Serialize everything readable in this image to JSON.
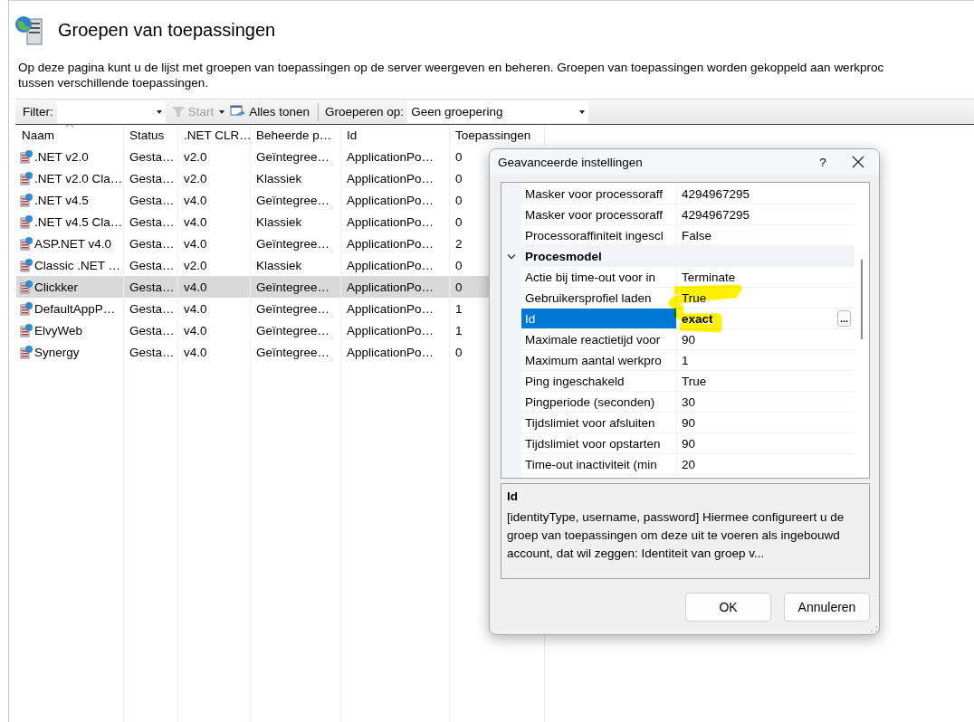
{
  "header": {
    "title": "Groepen van toepassingen",
    "description_lines": [
      "Op deze pagina kunt u de lijst met groepen van toepassingen op de server weergeven en beheren. Groepen van toepassingen worden gekoppeld aan werkproc",
      "tussen verschillende toepassingen."
    ]
  },
  "toolbar": {
    "filter_label": "Filter:",
    "start_button": {
      "label": "Start",
      "disabled": true
    },
    "show_all_button": "Alles tonen",
    "group_label": "Groeperen op:",
    "group_value": "Geen groepering"
  },
  "table": {
    "columns": [
      "Naam",
      "Status",
      ".NET CLR…",
      "Beheerde p…",
      "Id",
      "Toepassingen"
    ],
    "rows": [
      {
        "cells": [
          ".NET v2.0",
          "Gesta…",
          "v2.0",
          "Geïntegree…",
          "ApplicationPo…",
          "0"
        ],
        "selected": false
      },
      {
        "cells": [
          ".NET v2.0 Cla…",
          "Gesta…",
          "v2.0",
          "Klassiek",
          "ApplicationPo…",
          "0"
        ],
        "selected": false
      },
      {
        "cells": [
          ".NET v4.5",
          "Gesta…",
          "v4.0",
          "Geïntegree…",
          "ApplicationPo…",
          "0"
        ],
        "selected": false
      },
      {
        "cells": [
          ".NET v4.5 Cla…",
          "Gesta…",
          "v4.0",
          "Klassiek",
          "ApplicationPo…",
          "0"
        ],
        "selected": false
      },
      {
        "cells": [
          "ASP.NET v4.0",
          "Gesta…",
          "v4.0",
          "Geïntegree…",
          "ApplicationPo…",
          "2"
        ],
        "selected": false
      },
      {
        "cells": [
          "Classic .NET …",
          "Gesta…",
          "v2.0",
          "Klassiek",
          "ApplicationPo…",
          "0"
        ],
        "selected": false
      },
      {
        "cells": [
          "Clickker",
          "Gesta…",
          "v4.0",
          "Geïntegree…",
          "ApplicationPo…",
          "0"
        ],
        "selected": true
      },
      {
        "cells": [
          "DefaultAppP…",
          "Gesta…",
          "v4.0",
          "Geïntegree…",
          "ApplicationPo…",
          "1"
        ],
        "selected": false
      },
      {
        "cells": [
          "ElvyWeb",
          "Gesta…",
          "v4.0",
          "Geïntegree…",
          "ApplicationPo…",
          "1"
        ],
        "selected": false
      },
      {
        "cells": [
          "Synergy",
          "Gesta…",
          "v4.0",
          "Geïntegree…",
          "ApplicationPo…",
          "0"
        ],
        "selected": false
      }
    ]
  },
  "dialog": {
    "title": "Geavanceerde instellingen",
    "help": "?",
    "grid": [
      {
        "kind": "property",
        "name": "Masker voor processoraff",
        "value": "4294967295",
        "selected": false
      },
      {
        "kind": "property",
        "name": "Masker voor processoraff",
        "value": "4294967295",
        "selected": false
      },
      {
        "kind": "property",
        "name": "Processoraffiniteit ingescl",
        "value": "False",
        "selected": false
      },
      {
        "kind": "category",
        "name": "Procesmodel",
        "expanded": true
      },
      {
        "kind": "property",
        "name": "Actie bij time-out voor in",
        "value": "Terminate",
        "selected": false
      },
      {
        "kind": "property",
        "name": "Gebruikersprofiel laden",
        "value": "True",
        "selected": false
      },
      {
        "kind": "property",
        "name": "Id",
        "value": "exact",
        "selected": true,
        "button": "..."
      },
      {
        "kind": "property",
        "name": "Maximale reactietijd voor",
        "value": "90",
        "selected": false
      },
      {
        "kind": "property",
        "name": "Maximum aantal werkpro",
        "value": "1",
        "selected": false
      },
      {
        "kind": "property",
        "name": "Ping ingeschakeld",
        "value": "True",
        "selected": false
      },
      {
        "kind": "property",
        "name": "Pingperiode (seconden)",
        "value": "30",
        "selected": false
      },
      {
        "kind": "property",
        "name": "Tijdslimiet voor afsluiten",
        "value": "90",
        "selected": false
      },
      {
        "kind": "property",
        "name": "Tijdslimiet voor opstarten",
        "value": "90",
        "selected": false
      },
      {
        "kind": "property",
        "name": "Time-out inactiviteit (min",
        "value": "20",
        "selected": false
      }
    ],
    "description": {
      "title": "Id",
      "text": "[identityType, username, password] Hiermee configureert u de groep van toepassingen om deze uit te voeren als ingebouwd account, dat wil zeggen: Identiteit van groep v..."
    },
    "buttons": [
      "OK",
      "Annuleren"
    ]
  }
}
